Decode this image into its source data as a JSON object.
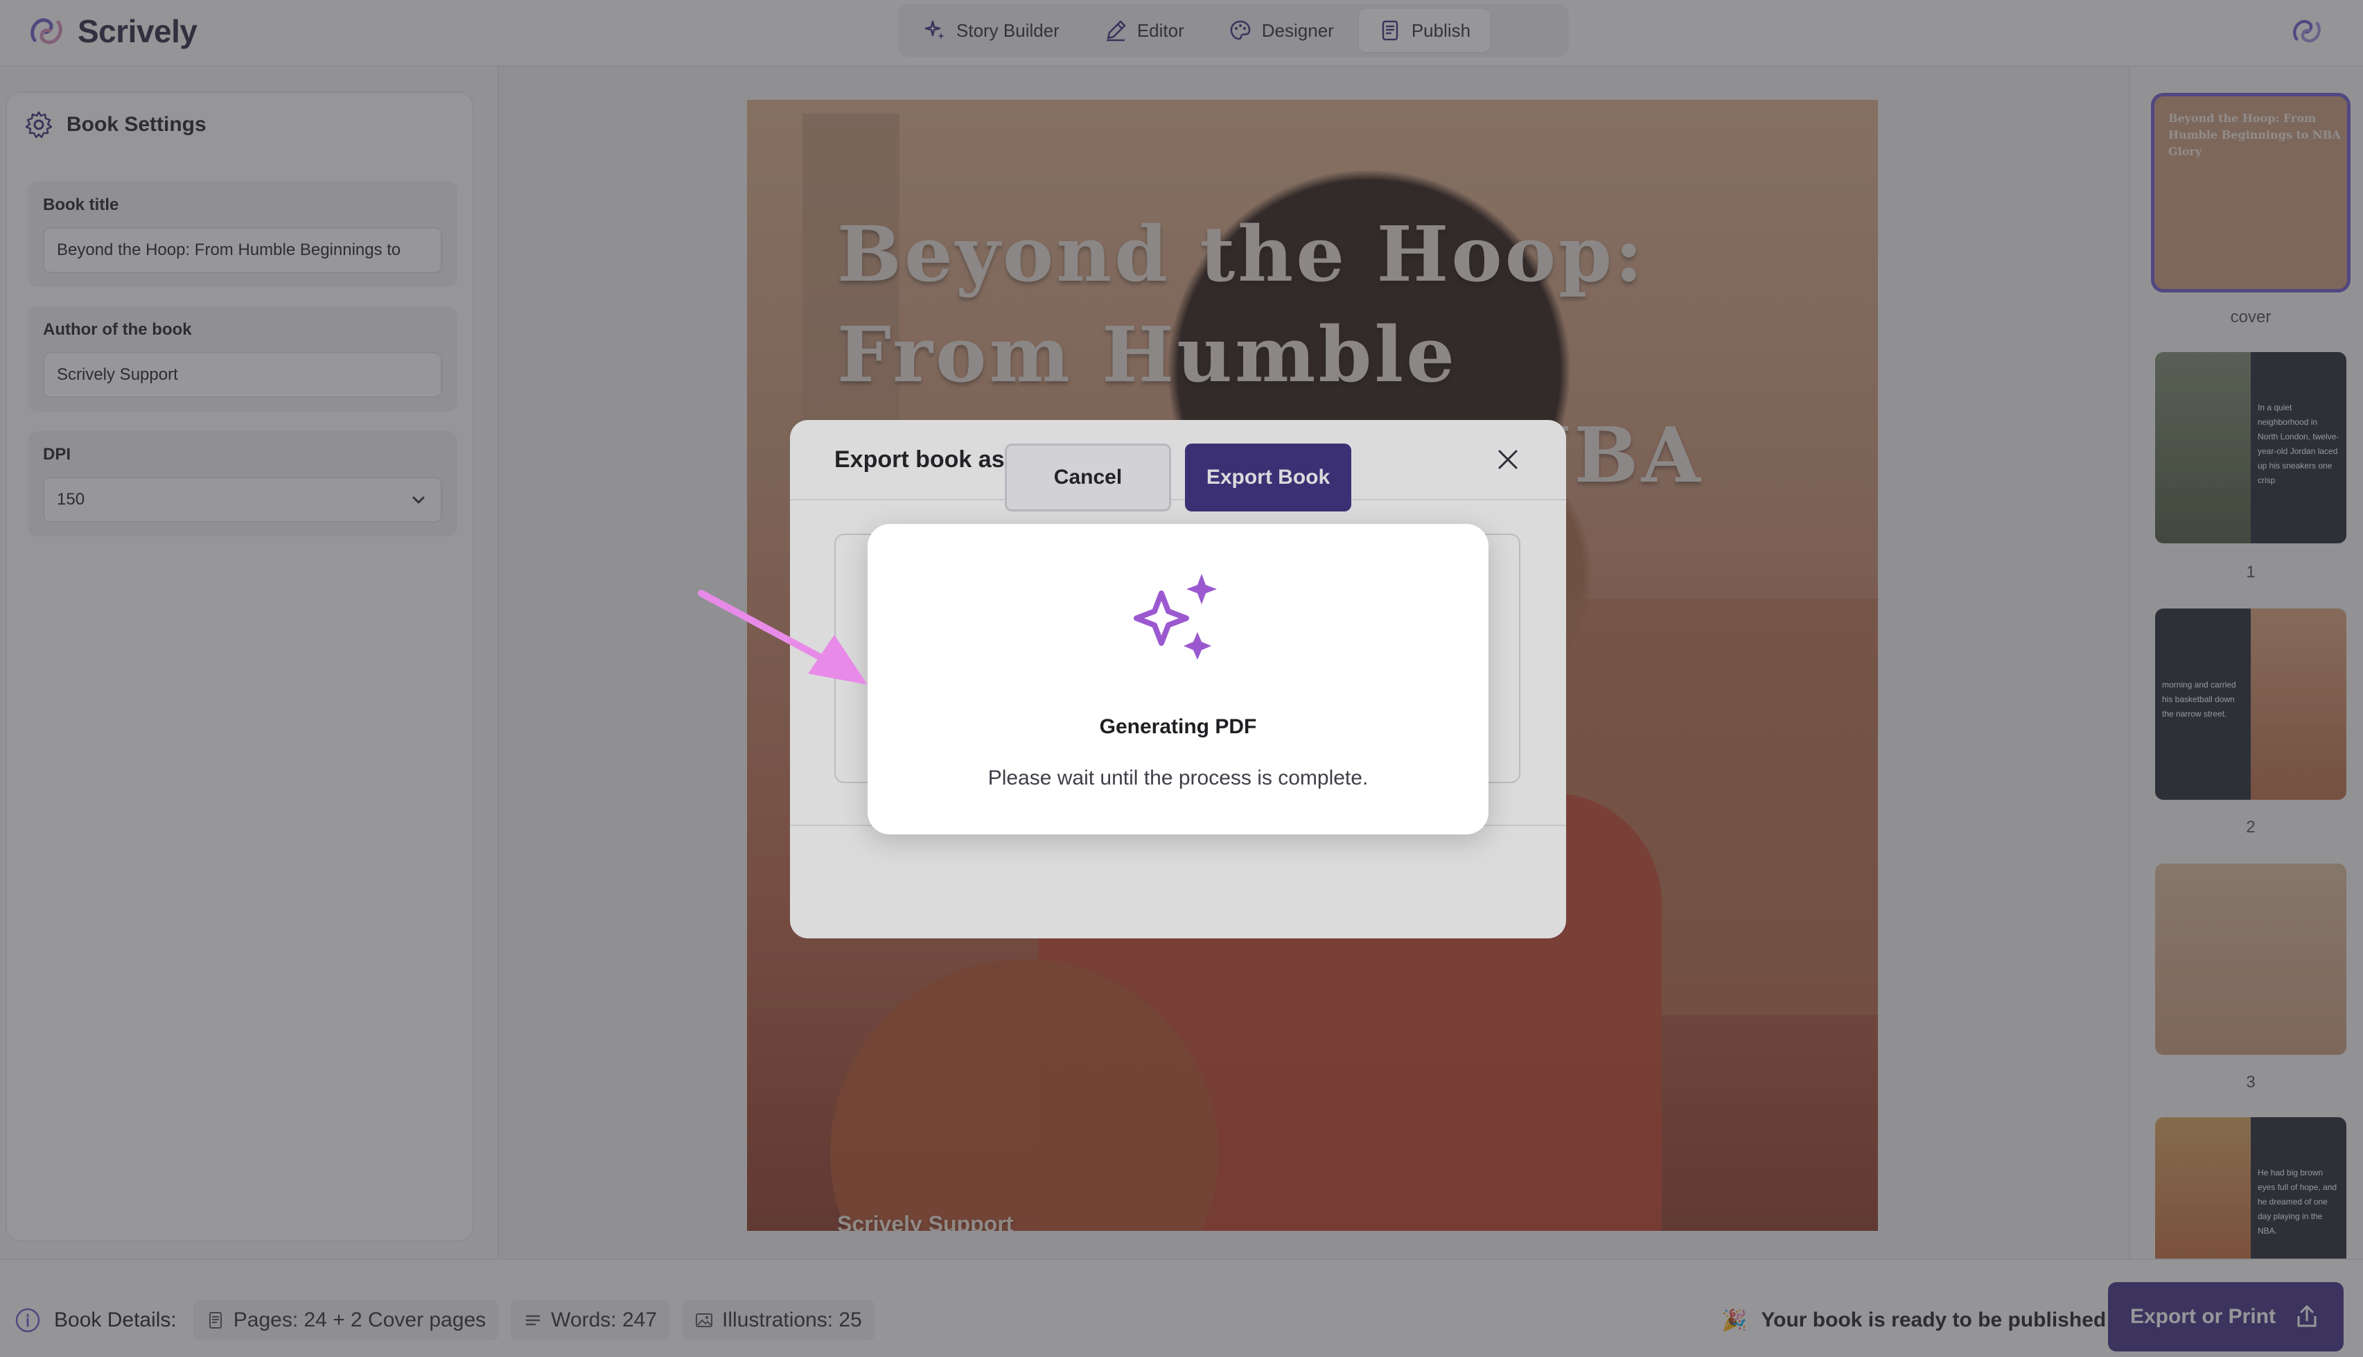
{
  "app": {
    "name": "Scrively"
  },
  "nav": {
    "tabs": [
      {
        "label": "Story Builder",
        "icon": "sparkle-icon"
      },
      {
        "label": "Editor",
        "icon": "pen-icon"
      },
      {
        "label": "Designer",
        "icon": "palette-icon"
      },
      {
        "label": "Publish",
        "icon": "document-icon",
        "active": true
      }
    ]
  },
  "settings": {
    "title": "Book Settings",
    "book_title_label": "Book title",
    "book_title_value": "Beyond the Hoop: From Humble Beginnings to",
    "author_label": "Author of the book",
    "author_value": "Scrively Support",
    "dpi_label": "DPI",
    "dpi_value": "150"
  },
  "cover": {
    "title": "Beyond the Hoop: From Humble Beginnings to NBA",
    "author": "Scrively Support"
  },
  "thumbnails": {
    "cover": {
      "label": "cover",
      "title": "Beyond the Hoop: From Humble Beginnings to NBA Glory"
    },
    "p1": {
      "label": "1",
      "text": "In a quiet neighborhood in North London, twelve-year-old Jordan laced up his sneakers one crisp"
    },
    "p2": {
      "label": "2",
      "text": "morning and carried his basketball down the narrow street."
    },
    "p3": {
      "label": "3"
    },
    "p4": {
      "text": "He had big brown eyes full of hope, and he dreamed of one day playing in the NBA."
    }
  },
  "bottom": {
    "details_label": "Book Details:",
    "pages": "Pages: 24 + 2 Cover pages",
    "words": "Words: 247",
    "illustrations": "Illustrations: 25",
    "ready_emoji": "🎉",
    "ready_text": "Your book is ready to be published!",
    "export_print": "Export or Print"
  },
  "dialog": {
    "title": "Export book as",
    "cancel": "Cancel",
    "export": "Export Book"
  },
  "progress": {
    "title": "Generating PDF",
    "message": "Please wait until the process is complete."
  },
  "colors": {
    "brand": "#3e2f82",
    "accent": "#9b59d0",
    "arrow": "#e88be8"
  }
}
